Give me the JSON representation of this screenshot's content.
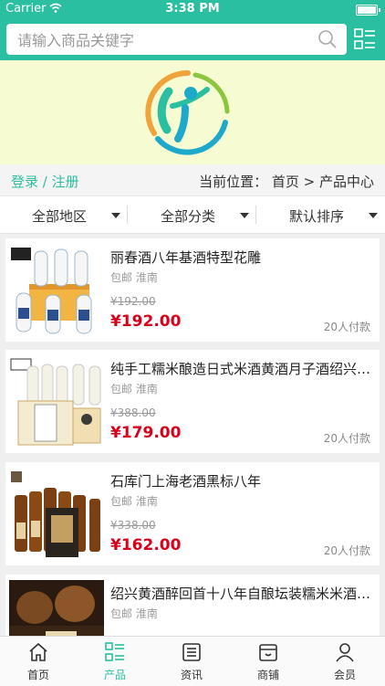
{
  "status": {
    "carrier": "Carrier",
    "time": "3:38 PM"
  },
  "search": {
    "placeholder": "请输入商品关键字"
  },
  "breadcrumb": {
    "login": "登录",
    "slash": " / ",
    "register": "注册",
    "location": "当前位置： 首页 > 产品中心"
  },
  "filters": {
    "region": "全部地区",
    "category": "全部分类",
    "sort": "默认排序"
  },
  "products": [
    {
      "title": "丽春酒八年基酒特型花雕",
      "ship": "包邮 淮南",
      "old_price": "¥192.00",
      "price": "¥192.00",
      "sold": "20人付款"
    },
    {
      "title": "纯手工糯米酿造日式米酒黄酒月子酒绍兴黄酒",
      "ship": "包邮 淮南",
      "old_price": "¥388.00",
      "price": "¥179.00",
      "sold": "20人付款"
    },
    {
      "title": "石库门上海老酒黑标八年",
      "ship": "包邮 淮南",
      "old_price": "¥338.00",
      "price": "¥162.00",
      "sold": "20人付款"
    },
    {
      "title": "绍兴黄酒醉回首十八年自酿坛装糯米米酒原浆",
      "ship": "包邮 淮南",
      "old_price": "",
      "price": "",
      "sold": ""
    }
  ],
  "tabs": [
    {
      "label": "首页",
      "icon": "home-icon"
    },
    {
      "label": "产品",
      "icon": "product-grid-icon"
    },
    {
      "label": "资讯",
      "icon": "news-icon"
    },
    {
      "label": "商铺",
      "icon": "shop-icon"
    },
    {
      "label": "会员",
      "icon": "user-icon"
    }
  ],
  "colors": {
    "accent": "#2bbfa2",
    "price": "#d9001b",
    "banner": "#f6fbd2"
  }
}
